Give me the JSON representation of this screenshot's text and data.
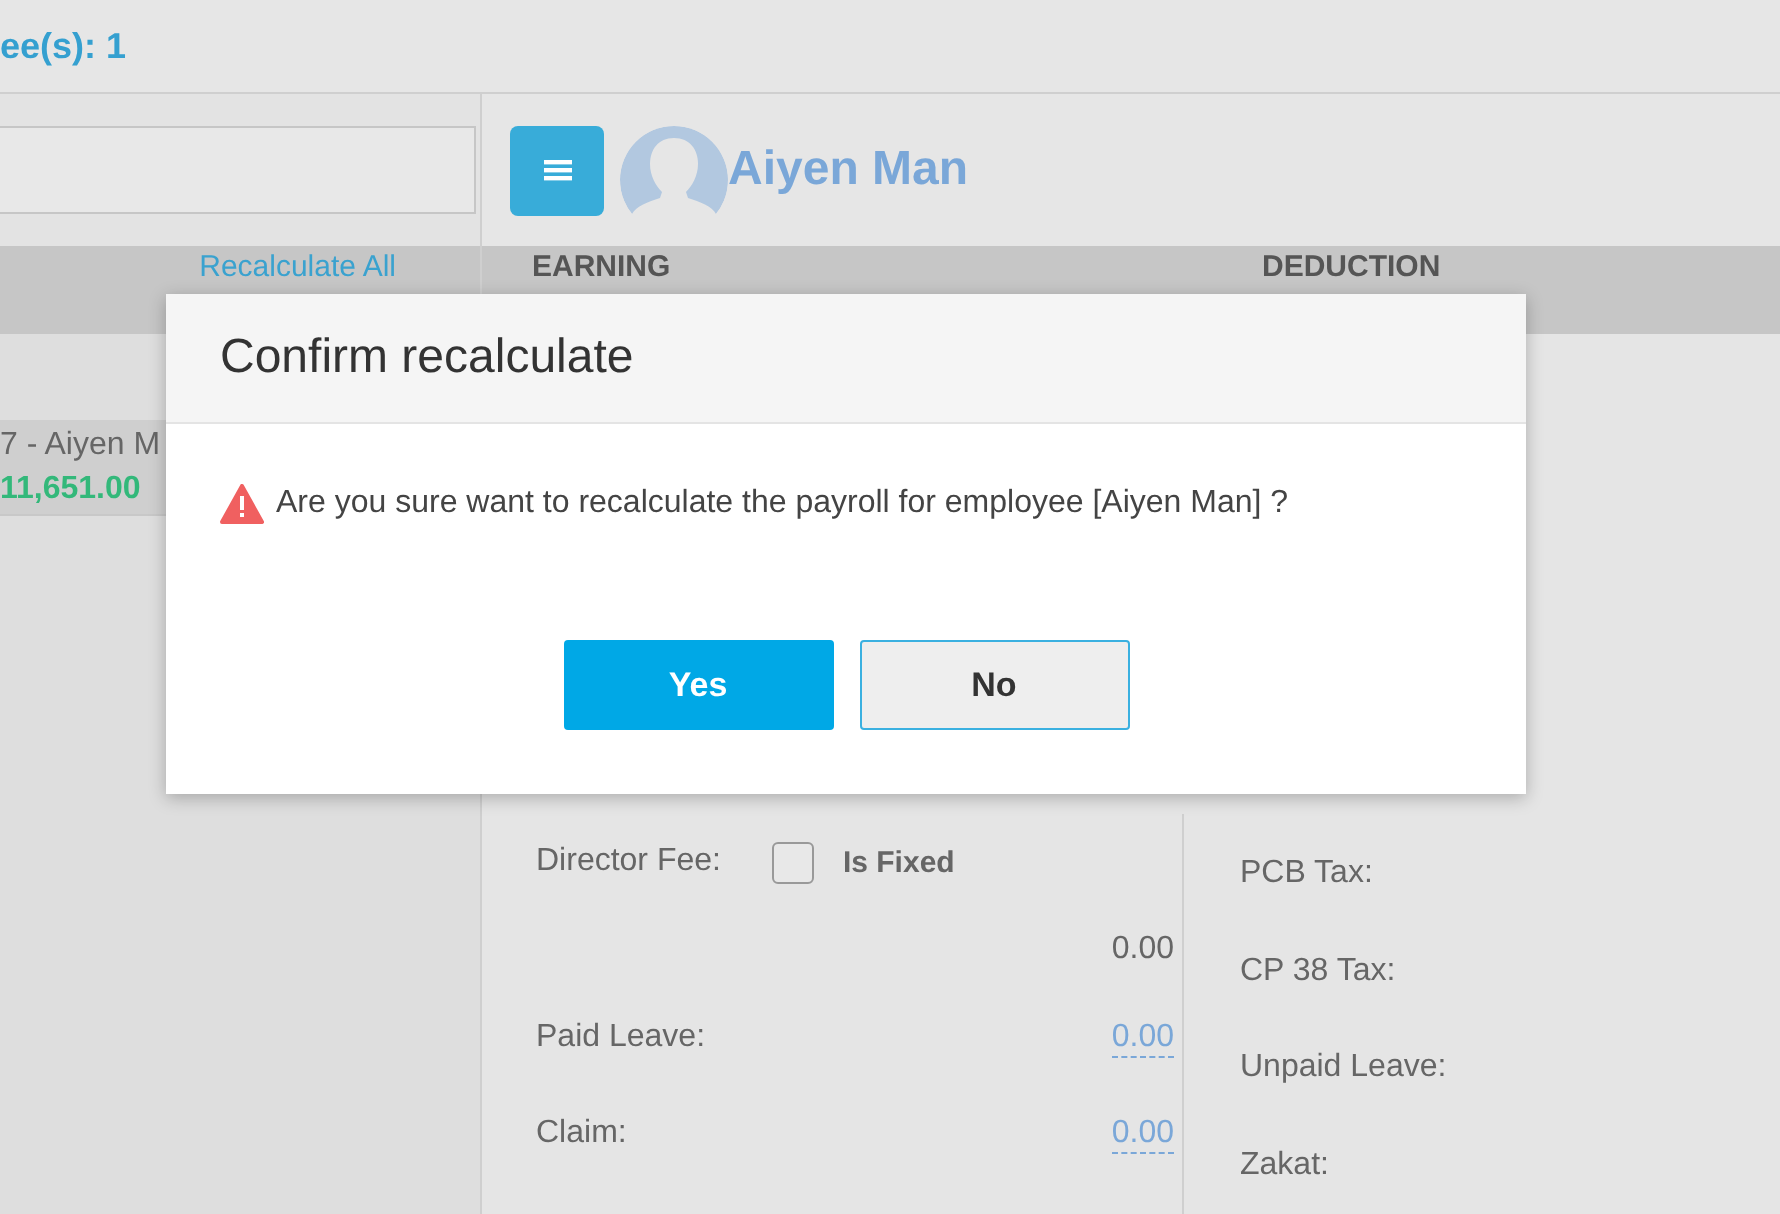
{
  "top_bar": {
    "text": "ee(s): 1"
  },
  "employee_list": {
    "recalculate_link": "Recalculate All",
    "items": [
      {
        "label": "7 - Aiyen M",
        "amount": "11,651.00",
        "selected": true
      }
    ]
  },
  "employee_header": {
    "name": "Aiyen Man"
  },
  "columns": [
    "EARNING",
    "DEDUCTION"
  ],
  "earnings": [
    {
      "kind": "checkbox",
      "label": "Director Fee:",
      "checkbox_label": "Is Fixed",
      "checked": false,
      "value": "0.00"
    },
    {
      "kind": "link",
      "label": "Paid Leave:",
      "value": "0.00"
    },
    {
      "kind": "link",
      "label": "Claim:",
      "value": "0.00"
    }
  ],
  "deductions": [
    {
      "label": "PCB Tax:"
    },
    {
      "label": "CP 38 Tax:"
    },
    {
      "label": "Unpaid Leave:"
    },
    {
      "label": "Zakat:"
    }
  ],
  "dialog": {
    "title": "Confirm recalculate",
    "message": "Are you sure want to recalculate the payroll for employee [Aiyen Man] ?",
    "buttons": [
      {
        "label": "Yes",
        "kind": "primary"
      },
      {
        "label": "No",
        "kind": "secondary"
      }
    ]
  }
}
